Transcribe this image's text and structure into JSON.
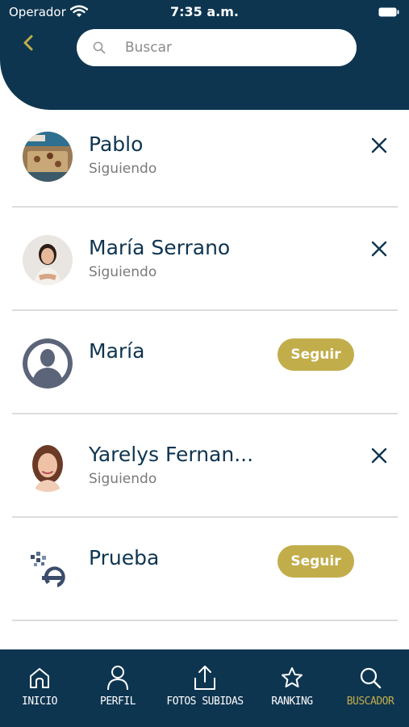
{
  "status_bar": {
    "carrier": "Operador",
    "time": "7:35 a.m."
  },
  "search": {
    "placeholder": "Buscar",
    "value": ""
  },
  "users": [
    {
      "name": "Pablo",
      "status": "Siguiendo",
      "action": "unfollow"
    },
    {
      "name": "María Serrano",
      "status": "Siguiendo",
      "action": "unfollow"
    },
    {
      "name": "María",
      "status": "",
      "action": "follow",
      "button_label": "Seguir"
    },
    {
      "name": "Yarelys Fernan...",
      "status": "Siguiendo",
      "action": "unfollow"
    },
    {
      "name": "Prueba",
      "status": "",
      "action": "follow",
      "button_label": "Seguir"
    }
  ],
  "tabs": [
    {
      "label": "INICIO",
      "icon": "home-icon"
    },
    {
      "label": "PERFIL",
      "icon": "user-icon"
    },
    {
      "label": "FOTOS SUBIDAS",
      "icon": "upload-icon"
    },
    {
      "label": "RANKING",
      "icon": "star-icon"
    },
    {
      "label": "BUSCADOR",
      "icon": "search-icon",
      "active": true
    }
  ],
  "colors": {
    "primary": "#0e3550",
    "accent": "#c2ad4b",
    "muted_text": "#7a7a7a",
    "divider": "#dcdcdc"
  }
}
